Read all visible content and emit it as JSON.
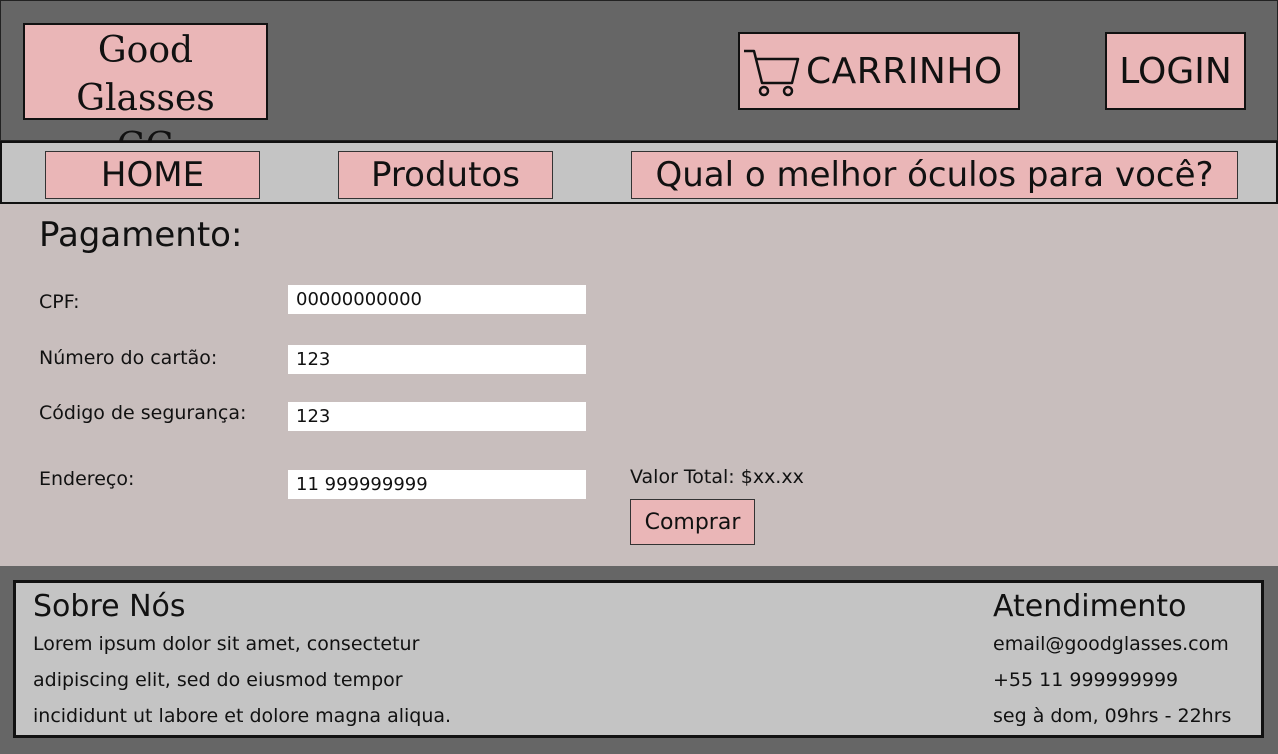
{
  "header": {
    "logo_line1": "Good Glasses",
    "logo_line2": "GG",
    "cart_label": "CARRINHO",
    "login_label": "LOGIN"
  },
  "nav": {
    "home": "HOME",
    "produtos": "Produtos",
    "melhor": "Qual o melhor óculos para você?"
  },
  "payment": {
    "title": "Pagamento:",
    "fields": [
      {
        "label": "CPF:",
        "value": "00000000000"
      },
      {
        "label": "Número do cartão:",
        "value": "123"
      },
      {
        "label": "Código de segurança:",
        "value": "123"
      },
      {
        "label": "Endereço:",
        "value": "11 999999999"
      }
    ],
    "total": "Valor Total: $xx.xx",
    "buy_label": "Comprar"
  },
  "footer": {
    "about_title": "Sobre Nós",
    "about_lines": [
      "Lorem ipsum dolor sit amet, consectetur",
      "adipiscing elit, sed do eiusmod tempor",
      "incididunt ut labore et dolore magna aliqua."
    ],
    "contact_title": "Atendimento",
    "contact_lines": [
      "email@goodglasses.com",
      "+55 11 999999999",
      "seg à dom, 09hrs - 22hrs"
    ]
  },
  "colors": {
    "header_bg": "#666666",
    "button_pink": "#eab6b7",
    "main_bg": "#c8bebd",
    "nav_bg": "#c4c4c4"
  },
  "icons": {
    "cart": "cart-icon"
  }
}
